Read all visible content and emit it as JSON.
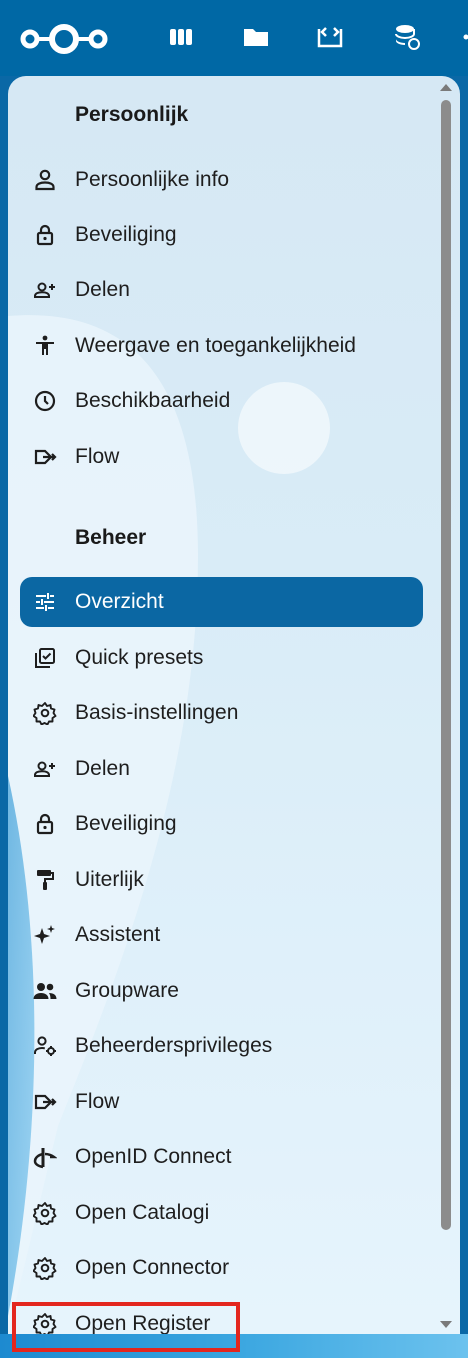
{
  "colors": {
    "header_bg": "#0068a5",
    "active_bg": "#0b67a3",
    "highlight": "#e3261e"
  },
  "header": {
    "logo": "nextcloud-logo",
    "apps": [
      {
        "icon": "dashboard-icon"
      },
      {
        "icon": "files-icon"
      },
      {
        "icon": "code-window-icon"
      },
      {
        "icon": "database-sync-icon"
      }
    ]
  },
  "personal": {
    "title": "Persoonlijk",
    "items": [
      {
        "label": "Persoonlijke info",
        "icon": "person-icon"
      },
      {
        "label": "Beveiliging",
        "icon": "lock-icon"
      },
      {
        "label": "Delen",
        "icon": "share-person-icon"
      },
      {
        "label": "Weergave en toegankelijkheid",
        "icon": "accessibility-icon"
      },
      {
        "label": "Beschikbaarheid",
        "icon": "clock-icon"
      },
      {
        "label": "Flow",
        "icon": "flow-icon"
      }
    ]
  },
  "admin": {
    "title": "Beheer",
    "items": [
      {
        "label": "Overzicht",
        "icon": "tune-icon",
        "active": true
      },
      {
        "label": "Quick presets",
        "icon": "checklist-icon"
      },
      {
        "label": "Basis-instellingen",
        "icon": "gear-icon"
      },
      {
        "label": "Delen",
        "icon": "share-person-icon"
      },
      {
        "label": "Beveiliging",
        "icon": "lock-icon"
      },
      {
        "label": "Uiterlijk",
        "icon": "paint-roller-icon"
      },
      {
        "label": "Assistent",
        "icon": "sparkles-icon"
      },
      {
        "label": "Groupware",
        "icon": "group-icon"
      },
      {
        "label": "Beheerdersprivileges",
        "icon": "admin-gear-icon"
      },
      {
        "label": "Flow",
        "icon": "flow-icon"
      },
      {
        "label": "OpenID Connect",
        "icon": "openid-icon"
      },
      {
        "label": "Open Catalogi",
        "icon": "gear-icon"
      },
      {
        "label": "Open Connector",
        "icon": "gear-icon"
      },
      {
        "label": "Open Register",
        "icon": "gear-icon",
        "highlighted": true
      }
    ]
  }
}
